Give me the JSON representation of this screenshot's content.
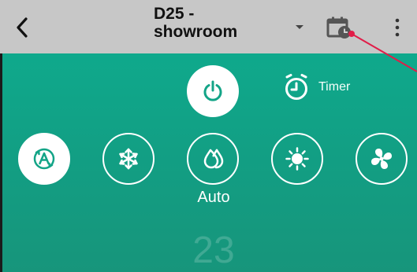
{
  "header": {
    "title_line1": "D25 -",
    "title_line2": "showroom"
  },
  "icons": {
    "back": "chevron-left-icon",
    "dropdown": "chevron-down-icon",
    "schedule": "calendar-clock-icon",
    "more": "more-vertical-icon",
    "power": "power-icon",
    "timer": "alarm-clock-icon",
    "auto": "auto-mode-icon",
    "cool": "snowflake-icon",
    "dry": "droplet-icon",
    "heat": "sun-icon",
    "fan": "fan-icon"
  },
  "controls": {
    "timer_label": "Timer",
    "selected_mode_label": "Auto",
    "temperature": "23",
    "modes": [
      {
        "name": "auto",
        "selected": true
      },
      {
        "name": "cool",
        "selected": false
      },
      {
        "name": "dry",
        "selected": false
      },
      {
        "name": "heat",
        "selected": false
      },
      {
        "name": "fan",
        "selected": false
      }
    ]
  },
  "colors": {
    "header_bg": "#c7c7c7",
    "panel_bg": "#129f84",
    "annotation": "#e11d48"
  }
}
